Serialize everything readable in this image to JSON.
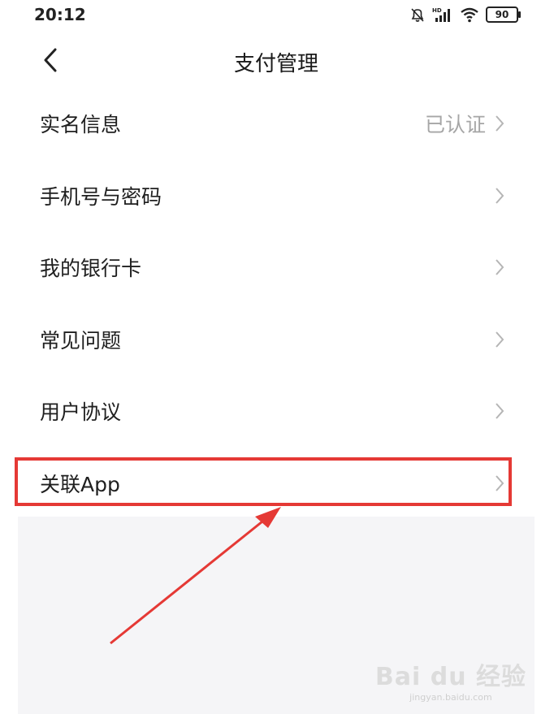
{
  "status": {
    "time": "20:12",
    "battery": "90",
    "icons": [
      "mute-bell-icon",
      "hd-signal-icon",
      "wifi-icon",
      "battery-icon"
    ]
  },
  "header": {
    "title": "支付管理",
    "back_icon": "chevron-left-icon"
  },
  "menu": {
    "items": [
      {
        "label": "实名信息",
        "value": "已认证"
      },
      {
        "label": "手机号与密码",
        "value": ""
      },
      {
        "label": "我的银行卡",
        "value": ""
      },
      {
        "label": "常见问题",
        "value": ""
      },
      {
        "label": "用户协议",
        "value": ""
      },
      {
        "label": "关联App",
        "value": ""
      }
    ]
  },
  "annotation": {
    "highlight_color": "#e53935"
  },
  "watermark": {
    "main": "Bai du 经验",
    "sub": "jingyan.baidu.com"
  }
}
